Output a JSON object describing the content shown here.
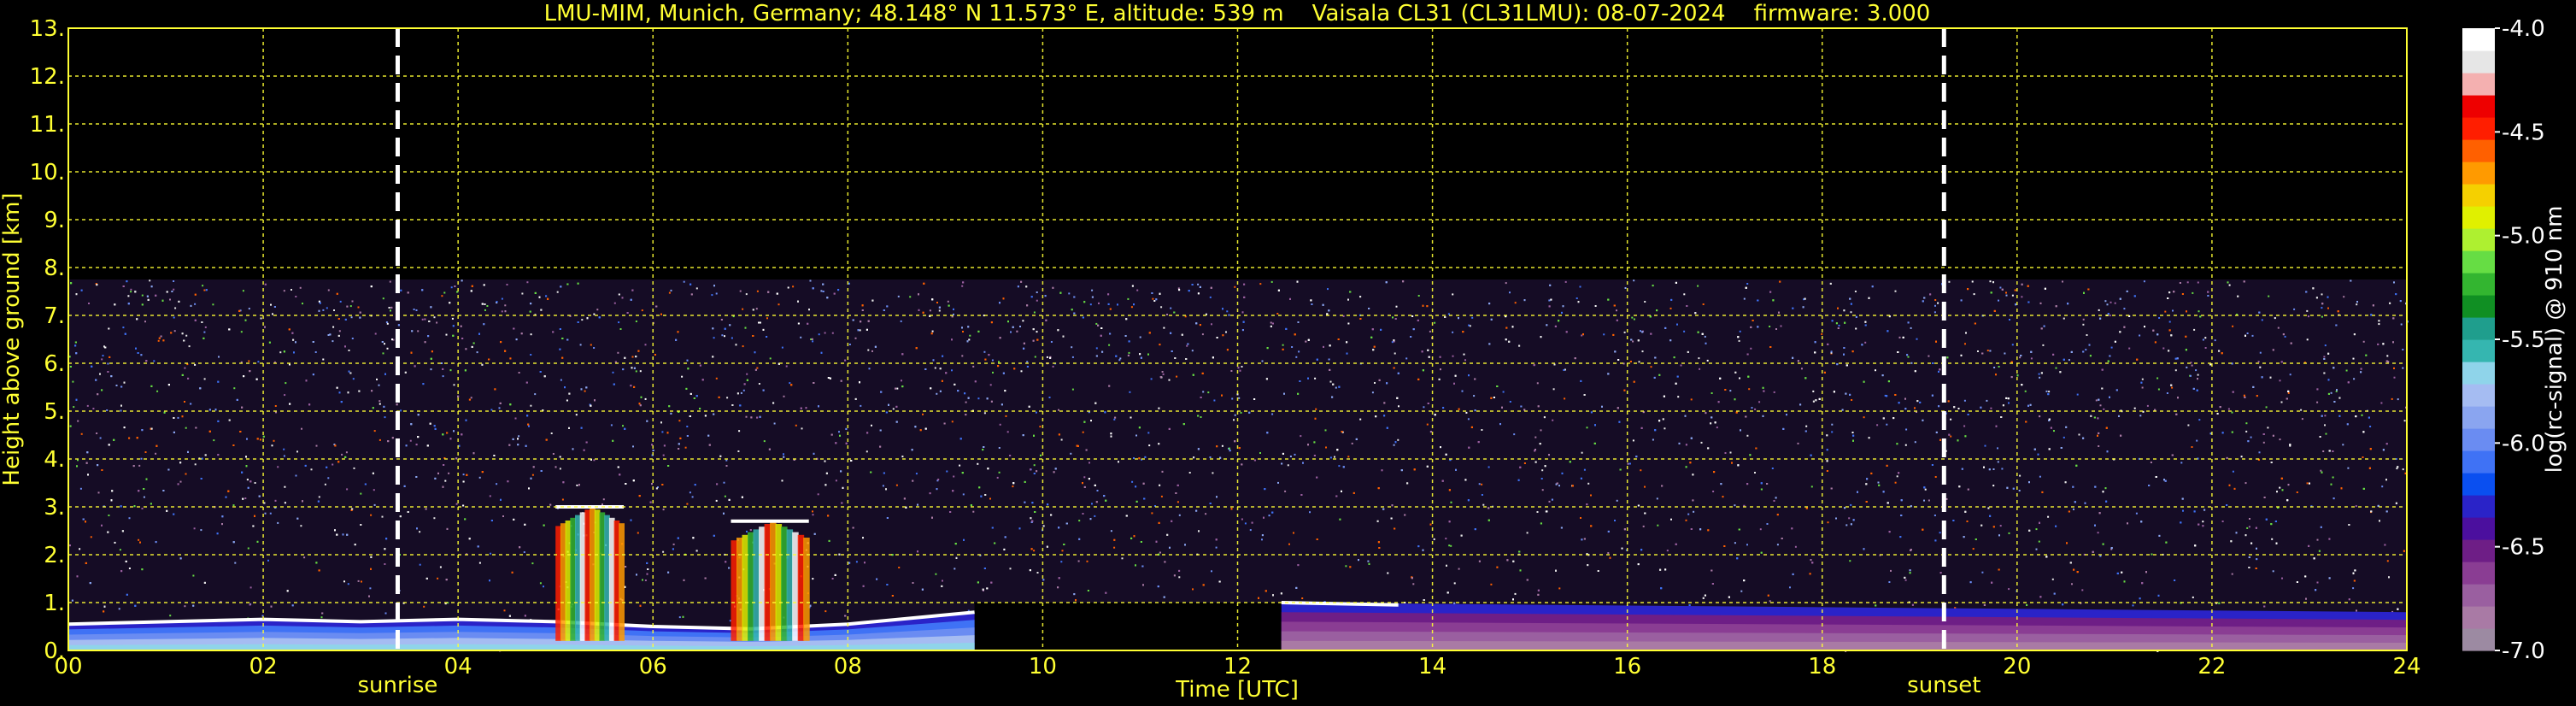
{
  "chart_data": {
    "type": "heatmap",
    "title": "LMU-MIM, Munich, Germany; 48.148° N 11.573° E, altitude: 539 m    Vaisala CL31 (CL31LMU): 08-07-2024    firmware: 3.000",
    "xlabel": "Time [UTC]",
    "ylabel": "Height above ground [km]",
    "xlim": [
      0,
      24
    ],
    "ylim": [
      0,
      13
    ],
    "xticks": [
      "00",
      "02",
      "04",
      "06",
      "08",
      "10",
      "12",
      "14",
      "16",
      "18",
      "20",
      "22",
      "24"
    ],
    "yticks": [
      "0.",
      "1.",
      "2.",
      "3.",
      "4.",
      "5.",
      "6.",
      "7.",
      "8.",
      "9.",
      "10.",
      "11.",
      "12.",
      "13."
    ],
    "grid": true,
    "markers": [
      {
        "label": "sunrise",
        "time": 3.38
      },
      {
        "label": "sunset",
        "time": 19.25
      }
    ],
    "colorbar": {
      "label": "log(rc-signal) @ 910 nm",
      "range": [
        -7.0,
        -4.0
      ],
      "ticks": [
        "-4.0",
        "-4.5",
        "-5.0",
        "-5.5",
        "-6.0",
        "-6.5",
        "-7.0"
      ],
      "colors": [
        "#9c8aa2",
        "#a97aa5",
        "#9a5fa0",
        "#8a3d93",
        "#6e1e86",
        "#4b0f9e",
        "#2a23c8",
        "#0a4ff0",
        "#3f72f5",
        "#6a8cf2",
        "#8aa5f0",
        "#a5bcf2",
        "#8fd4ea",
        "#35b6b0",
        "#1f9e8d",
        "#108f23",
        "#33b530",
        "#66dd44",
        "#aef030",
        "#e0f000",
        "#f5d000",
        "#ff9a00",
        "#ff6000",
        "#ff1e00",
        "#ee0000",
        "#f4b0b0",
        "#e6e6e6",
        "#ffffff"
      ]
    },
    "layers": [
      {
        "name": "noise",
        "t": [
          0,
          24
        ],
        "top_km": 7.75
      },
      {
        "name": "boundary-layer",
        "t": [
          0.0,
          1.0,
          2.0,
          3.0,
          4.0,
          5.0,
          6.0,
          7.0,
          8.0,
          9.3
        ],
        "top_km": [
          0.55,
          0.6,
          0.65,
          0.6,
          0.65,
          0.6,
          0.5,
          0.45,
          0.55,
          0.8
        ]
      },
      {
        "name": "cloud",
        "t": [
          5.0,
          5.7
        ],
        "base_km": 0.2,
        "top_km": 3.0
      },
      {
        "name": "cloud",
        "t": [
          6.8,
          7.6
        ],
        "base_km": 0.2,
        "top_km": 2.7
      },
      {
        "name": "aerosol",
        "t": [
          12.45,
          24.0
        ],
        "top_km": [
          1.0,
          0.8
        ]
      },
      {
        "name": "data-gap",
        "t": [
          9.3,
          12.45
        ],
        "below_km": 1.0
      }
    ]
  }
}
